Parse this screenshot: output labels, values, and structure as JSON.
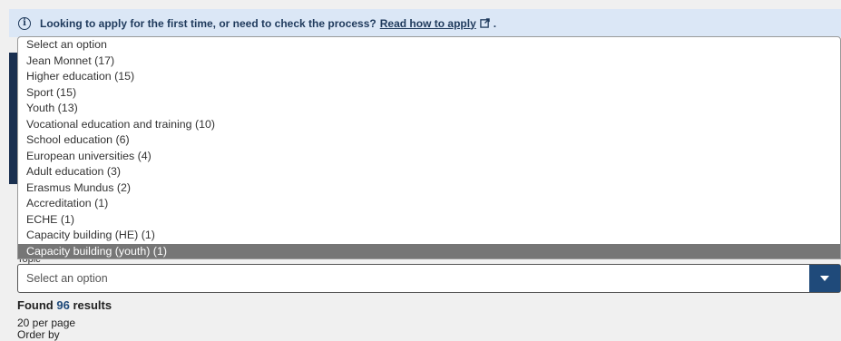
{
  "banner": {
    "icon": "info-icon",
    "text": "Looking to apply for the first time, or need to check the process?",
    "link_text": "Read how to apply",
    "suffix": "."
  },
  "dropdown": {
    "options": [
      "Select an option",
      "Jean Monnet (17)",
      "Higher education (15)",
      "Sport (15)",
      "Youth (13)",
      "Vocational education and training (10)",
      "School education (6)",
      "European universities (4)",
      "Adult education (3)",
      "Erasmus Mundus (2)",
      "Accreditation (1)",
      "ECHE (1)",
      "Capacity building (HE) (1)",
      "Capacity building (youth) (1)"
    ],
    "highlighted_index": 13
  },
  "topic": {
    "label": "Topic",
    "placeholder": "Select an option"
  },
  "results": {
    "prefix": "Found",
    "count": "96",
    "suffix": "results"
  },
  "per_page": "20 per page",
  "order_by": "Order by",
  "colors": {
    "banner_bg": "#dbe7f6",
    "accent": "#1f4a7a",
    "highlight": "#767676"
  }
}
